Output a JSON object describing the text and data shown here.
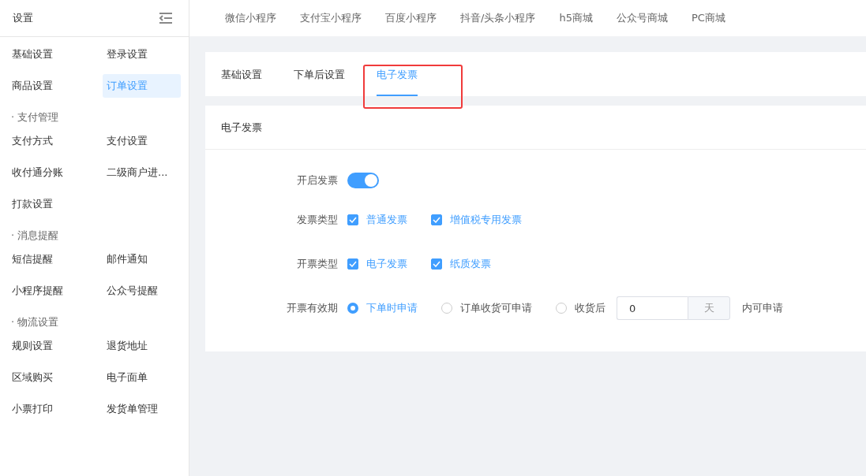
{
  "sidebar": {
    "title": "设置",
    "sections": [
      {
        "items": [
          {
            "label": "基础设置",
            "selected": false
          },
          {
            "label": "登录设置",
            "selected": false
          },
          {
            "label": "商品设置",
            "selected": false
          },
          {
            "label": "订单设置",
            "selected": true
          }
        ]
      },
      {
        "title": "· 支付管理",
        "items": [
          {
            "label": "支付方式",
            "selected": false
          },
          {
            "label": "支付设置",
            "selected": false
          },
          {
            "label": "收付通分账",
            "selected": false
          },
          {
            "label": "二级商户进...",
            "selected": false
          },
          {
            "label": "打款设置",
            "selected": false
          }
        ]
      },
      {
        "title": "· 消息提醒",
        "items": [
          {
            "label": "短信提醒",
            "selected": false
          },
          {
            "label": "邮件通知",
            "selected": false
          },
          {
            "label": "小程序提醒",
            "selected": false
          },
          {
            "label": "公众号提醒",
            "selected": false
          }
        ]
      },
      {
        "title": "· 物流设置",
        "items": [
          {
            "label": "规则设置",
            "selected": false
          },
          {
            "label": "退货地址",
            "selected": false
          },
          {
            "label": "区域购买",
            "selected": false
          },
          {
            "label": "电子面单",
            "selected": false
          },
          {
            "label": "小票打印",
            "selected": false
          },
          {
            "label": "发货单管理",
            "selected": false
          }
        ]
      }
    ]
  },
  "top_nav": [
    "微信小程序",
    "支付宝小程序",
    "百度小程序",
    "抖音/头条小程序",
    "h5商城",
    "公众号商城",
    "PC商城"
  ],
  "tabs": [
    {
      "label": "基础设置",
      "selected": false
    },
    {
      "label": "下单后设置",
      "selected": false
    },
    {
      "label": "电子发票",
      "selected": true
    }
  ],
  "panel": {
    "title": "电子发票",
    "fields": [
      {
        "kind": "switch",
        "label": "开启发票",
        "on": true
      },
      {
        "kind": "checkboxes",
        "label": "发票类型",
        "options": [
          {
            "label": "普通发票",
            "checked": true
          },
          {
            "label": "增值税专用发票",
            "checked": true
          }
        ]
      },
      {
        "kind": "checkboxes",
        "label": "开票类型",
        "options": [
          {
            "label": "电子发票",
            "checked": true
          },
          {
            "label": "纸质发票",
            "checked": true
          }
        ]
      },
      {
        "kind": "radios",
        "label": "开票有效期",
        "options": [
          {
            "label": "下单时申请",
            "selected": true
          },
          {
            "label": "订单收货可申请",
            "selected": false
          },
          {
            "label": "收货后",
            "selected": false
          }
        ],
        "days": {
          "value": "0",
          "unit": "天"
        },
        "suffix": "内可申请"
      }
    ]
  }
}
